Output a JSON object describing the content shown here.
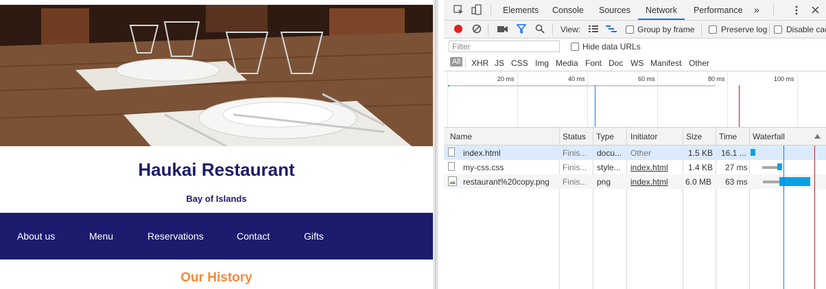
{
  "site": {
    "title": "Haukai Restaurant",
    "subtitle": "Bay of Islands",
    "nav": [
      "About us",
      "Menu",
      "Reservations",
      "Contact",
      "Gifts"
    ],
    "section_heading": "Our History",
    "colors": {
      "nav_bg": "#1c1c6f",
      "title": "#1b1b6b",
      "heading": "#f58a3b"
    }
  },
  "devtools": {
    "tabs": [
      "Elements",
      "Console",
      "Sources",
      "Network",
      "Performance"
    ],
    "active_tab": "Network",
    "more_icon": "»",
    "toolbar": {
      "view_label": "View:",
      "group_by_frame": "Group by frame",
      "preserve_log": "Preserve log",
      "disable_cache": "Disable cache"
    },
    "filter": {
      "placeholder": "Filter",
      "hide_data_urls": "Hide data URLs"
    },
    "types": [
      "All",
      "XHR",
      "JS",
      "CSS",
      "Img",
      "Media",
      "Font",
      "Doc",
      "WS",
      "Manifest",
      "Other"
    ],
    "overview_ticks": [
      "20 ms",
      "40 ms",
      "60 ms",
      "80 ms",
      "100 ms"
    ],
    "columns": [
      "Name",
      "Status",
      "Type",
      "Initiator",
      "Size",
      "Time",
      "Waterfall"
    ],
    "rows": [
      {
        "name": "index.html",
        "status": "Finis...",
        "type": "docu...",
        "initiator": "Other",
        "size": "1.5 KB",
        "time": "16.1 ..."
      },
      {
        "name": "my-css.css",
        "status": "Finis...",
        "type": "style...",
        "initiator": "index.html",
        "size": "1.4 KB",
        "time": "27 ms"
      },
      {
        "name": "restaurant%20copy.png",
        "status": "Finis...",
        "type": "png",
        "initiator": "index.html",
        "size": "6.0 MB",
        "time": "63 ms"
      }
    ],
    "colors": {
      "accent": "#1a73e8",
      "record": "#e02020",
      "bar": "#0aa1e6"
    }
  }
}
